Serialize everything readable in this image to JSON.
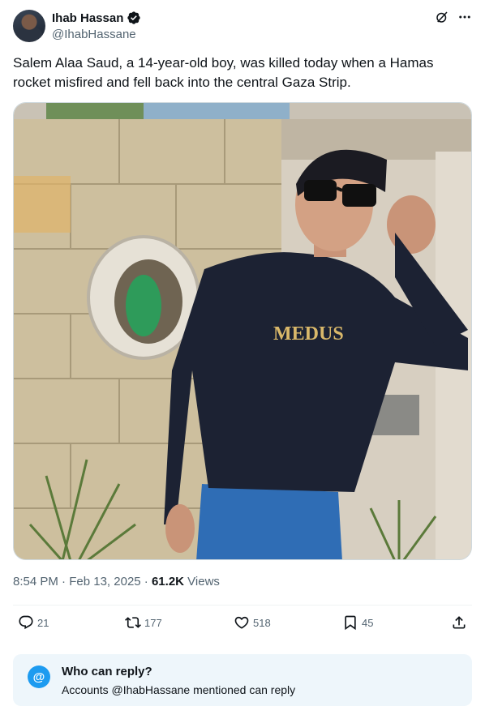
{
  "author": {
    "name": "Ihab Hassan",
    "handle": "@IhabHassane",
    "avatar_icon": "user-avatar-icon",
    "verified_icon": "verified-badge-icon"
  },
  "tweet": {
    "text": "Salem Alaa Saud, a 14-year-old boy, was killed today when a Hamas rocket misfired and fell back into the central Gaza Strip.",
    "time": "8:54 PM",
    "date": "Feb 13, 2025",
    "views_count": "61.2K",
    "views_label": "Views",
    "image_shirt_text": "MEDUS"
  },
  "actions": {
    "reply_count": "21",
    "repost_count": "177",
    "like_count": "518",
    "bookmark_count": "45"
  },
  "reply_restriction": {
    "badge": "@",
    "title": "Who can reply?",
    "subtitle": "Accounts @IhabHassane mentioned can reply"
  },
  "colors": {
    "accent": "#1d9bf0",
    "text_secondary": "#536471",
    "reply_box_bg": "#eef6fb"
  }
}
